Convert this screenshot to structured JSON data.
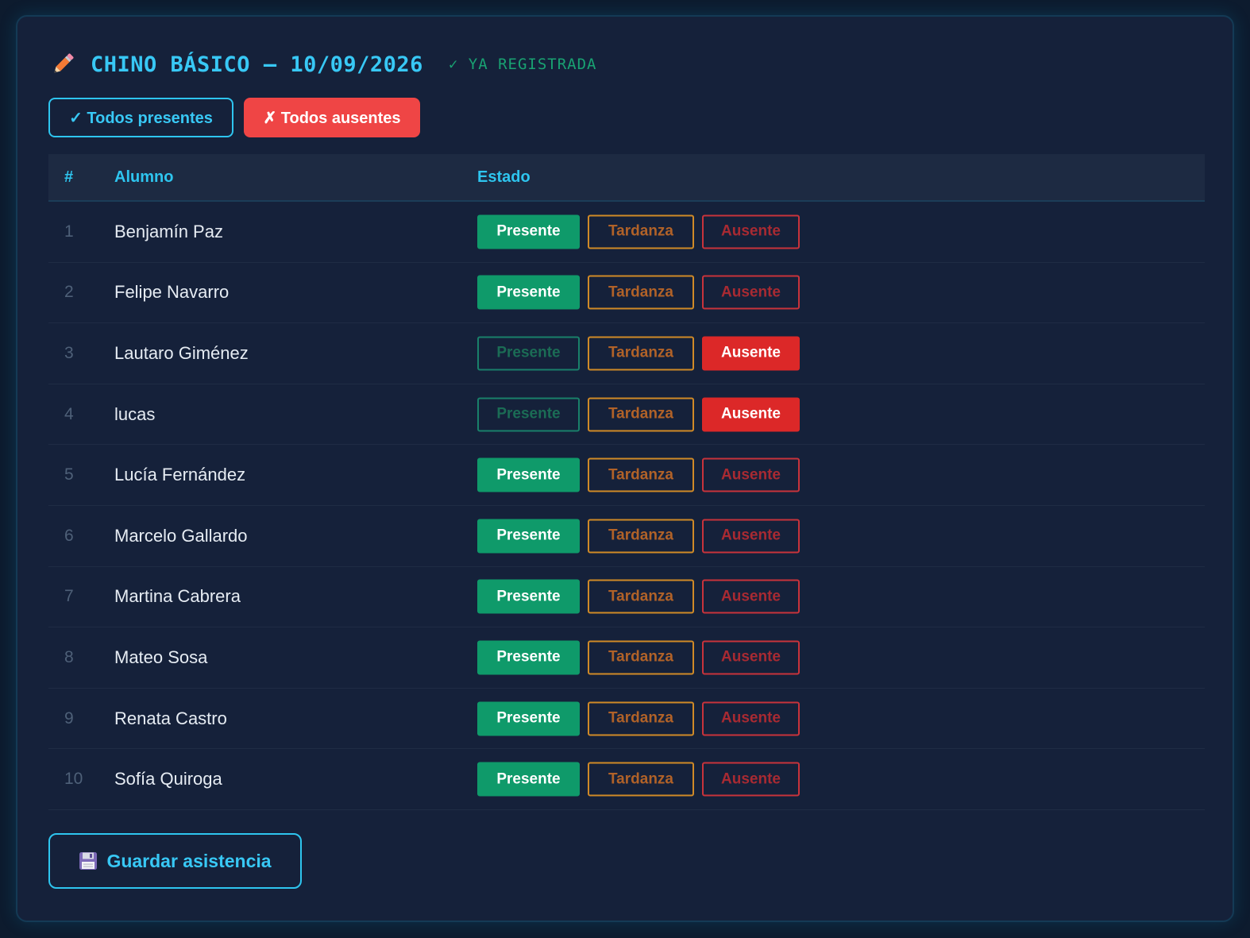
{
  "header": {
    "title": "CHINO BÁSICO — 10/09/2026",
    "status": "✓ YA REGISTRADA"
  },
  "bulk_actions": {
    "all_present": "✓ Todos presentes",
    "all_absent": "✗ Todos ausentes"
  },
  "table": {
    "columns": [
      "#",
      "Alumno",
      "Estado"
    ],
    "status_labels": {
      "present": "Presente",
      "late": "Tardanza",
      "absent": "Ausente"
    },
    "rows": [
      {
        "num": "1",
        "name": "Benjamín Paz",
        "status": "present"
      },
      {
        "num": "2",
        "name": "Felipe Navarro",
        "status": "present"
      },
      {
        "num": "3",
        "name": "Lautaro Giménez",
        "status": "absent"
      },
      {
        "num": "4",
        "name": "lucas",
        "status": "absent"
      },
      {
        "num": "5",
        "name": "Lucía Fernández",
        "status": "present"
      },
      {
        "num": "6",
        "name": "Marcelo Gallardo",
        "status": "present"
      },
      {
        "num": "7",
        "name": "Martina Cabrera",
        "status": "present"
      },
      {
        "num": "8",
        "name": "Mateo Sosa",
        "status": "present"
      },
      {
        "num": "9",
        "name": "Renata Castro",
        "status": "present"
      },
      {
        "num": "10",
        "name": "Sofía Quiroga",
        "status": "present"
      }
    ]
  },
  "save_button": {
    "label": "Guardar asistencia",
    "icon": "floppy-disk-icon"
  },
  "colors": {
    "accent": "#2ec5ef",
    "present": "#0f9a6a",
    "late": "#d08a27",
    "absent": "#dc2828"
  }
}
